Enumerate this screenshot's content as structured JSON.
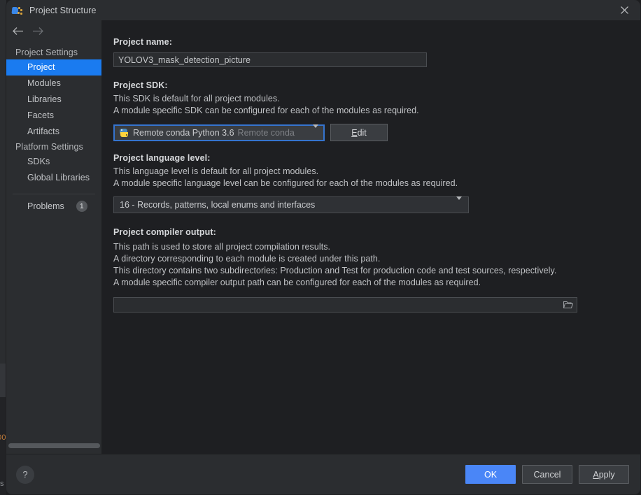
{
  "window": {
    "title": "Project Structure",
    "icon": "project-structure-icon",
    "close_icon": "close-icon"
  },
  "nav": {
    "back_icon": "arrow-left-icon",
    "forward_icon": "arrow-right-icon"
  },
  "sidebar": {
    "groups": [
      {
        "label": "Project Settings",
        "items": [
          {
            "label": "Project",
            "selected": true
          },
          {
            "label": "Modules",
            "selected": false
          },
          {
            "label": "Libraries",
            "selected": false
          },
          {
            "label": "Facets",
            "selected": false
          },
          {
            "label": "Artifacts",
            "selected": false
          }
        ]
      },
      {
        "label": "Platform Settings",
        "items": [
          {
            "label": "SDKs",
            "selected": false
          },
          {
            "label": "Global Libraries",
            "selected": false
          }
        ]
      }
    ],
    "problems": {
      "label": "Problems",
      "count": "1"
    }
  },
  "main": {
    "project_name": {
      "title": "Project name:",
      "value": "YOLOV3_mask_detection_picture"
    },
    "project_sdk": {
      "title": "Project SDK:",
      "desc_line1": "This SDK is default for all project modules.",
      "desc_line2": "A module specific SDK can be configured for each of the modules as required.",
      "selected": "Remote conda Python 3.6",
      "selected_sub": "Remote conda",
      "sdk_icon": "python-icon",
      "edit_button": "Edit",
      "edit_mnemonic": "E",
      "edit_rest": "dit"
    },
    "language_level": {
      "title": "Project language level:",
      "desc_line1": "This language level is default for all project modules.",
      "desc_line2": "A module specific language level can be configured for each of the modules as required.",
      "selected": "16 - Records, patterns, local enums and interfaces"
    },
    "compiler_output": {
      "title": "Project compiler output:",
      "desc_line1": "This path is used to store all project compilation results.",
      "desc_line2": "A directory corresponding to each module is created under this path.",
      "desc_line3": "This directory contains two subdirectories: Production and Test for production code and test sources, respectively.",
      "desc_line4": "A module specific compiler output path can be configured for each of the modules as required.",
      "value": "",
      "placeholder": "",
      "browse_icon": "folder-icon"
    }
  },
  "footer": {
    "help_label": "?",
    "ok_label": "OK",
    "cancel_label": "Cancel",
    "apply_label": "Apply",
    "apply_mnemonic": "A",
    "apply_rest": "pply"
  },
  "backdrop": {
    "text_number": "00",
    "text_s": "s"
  },
  "colors": {
    "accent_selection": "#1a7bf0",
    "accent_primary_button": "#4a86f7",
    "focus_border": "#3574cf",
    "dialog_bg": "#2b2d30",
    "content_bg": "#1e1f22"
  }
}
